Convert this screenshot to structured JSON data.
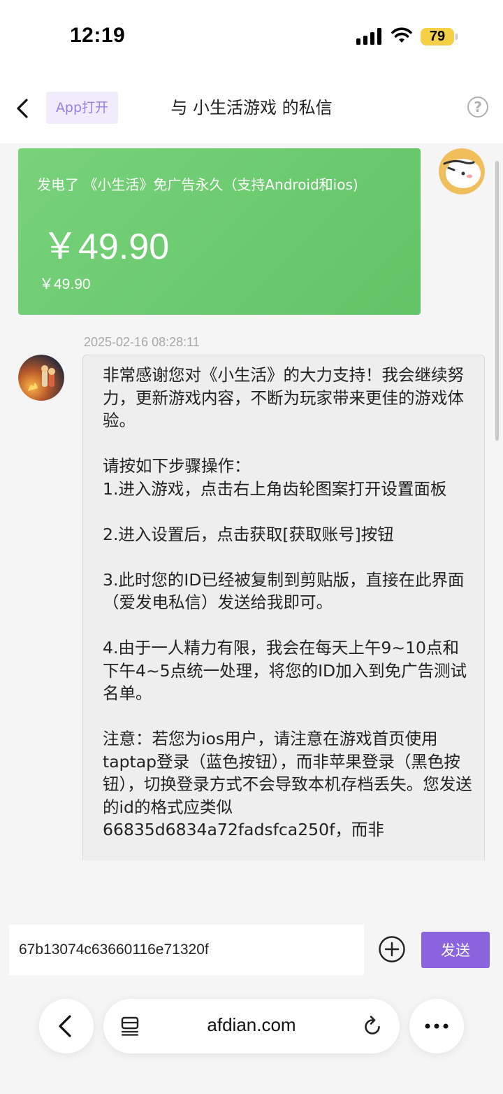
{
  "status": {
    "time": "12:19",
    "battery": "79"
  },
  "header": {
    "app_open_label": "App打开",
    "title": "与 小生活游戏 的私信"
  },
  "order_card": {
    "title": "发电了 《小生活》免广告永久（支持Android和ios)",
    "price": "￥49.90",
    "sub_price": "￥49.90"
  },
  "message": {
    "timestamp": "2025-02-16 08:28:11",
    "text": "非常感谢您对《小生活》的大力支持！我会继续努力，更新游戏内容，不断为玩家带来更佳的游戏体验。\n\n请按如下步骤操作：\n1.进入游戏，点击右上角齿轮图案打开设置面板\n\n2.进入设置后，点击获取[获取账号]按钮\n\n3.此时您的ID已经被复制到剪贴版，直接在此界面（爱发电私信）发送给我即可。\n\n4.由于一人精力有限，我会在每天上午9~10点和下午4~5点统一处理，将您的ID加入到免广告测试名单。\n\n注意：若您为ios用户，请注意在游戏首页使用taptap登录（蓝色按钮），而非苹果登录（黑色按钮），切换登录方式不会导致本机存档丢失。您发送的id的格式应类似66835d6834a72fadsfca250f，而非"
  },
  "composer": {
    "input_value": "67b13074c63660116e71320f",
    "send_label": "发送"
  },
  "browser": {
    "url": "afdian.com"
  },
  "colors": {
    "accent": "#8a64de",
    "order_card": "#6cc96f",
    "chat_bg": "#f5f5f5"
  },
  "icons": [
    "back-chevron-icon",
    "help-circle-icon",
    "plus-circle-icon",
    "tabs-icon",
    "reload-icon",
    "more-icon",
    "signal-icon",
    "wifi-icon"
  ]
}
